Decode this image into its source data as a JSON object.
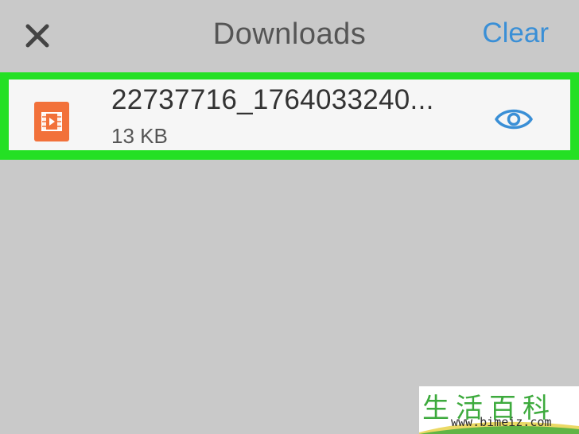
{
  "colors": {
    "accent": "#3a8fd6",
    "highlight": "#24e024",
    "file_icon": "#f2713a"
  },
  "header": {
    "close_icon": "close-icon",
    "title": "Downloads",
    "clear_label": "Clear"
  },
  "downloads": [
    {
      "icon": "video-file-icon",
      "name": "22737716_1764033240...",
      "size": "13 KB",
      "action_icon": "eye-icon"
    }
  ],
  "watermark": {
    "glyphs": "生活百科",
    "url": "www.bimeiz.com"
  }
}
